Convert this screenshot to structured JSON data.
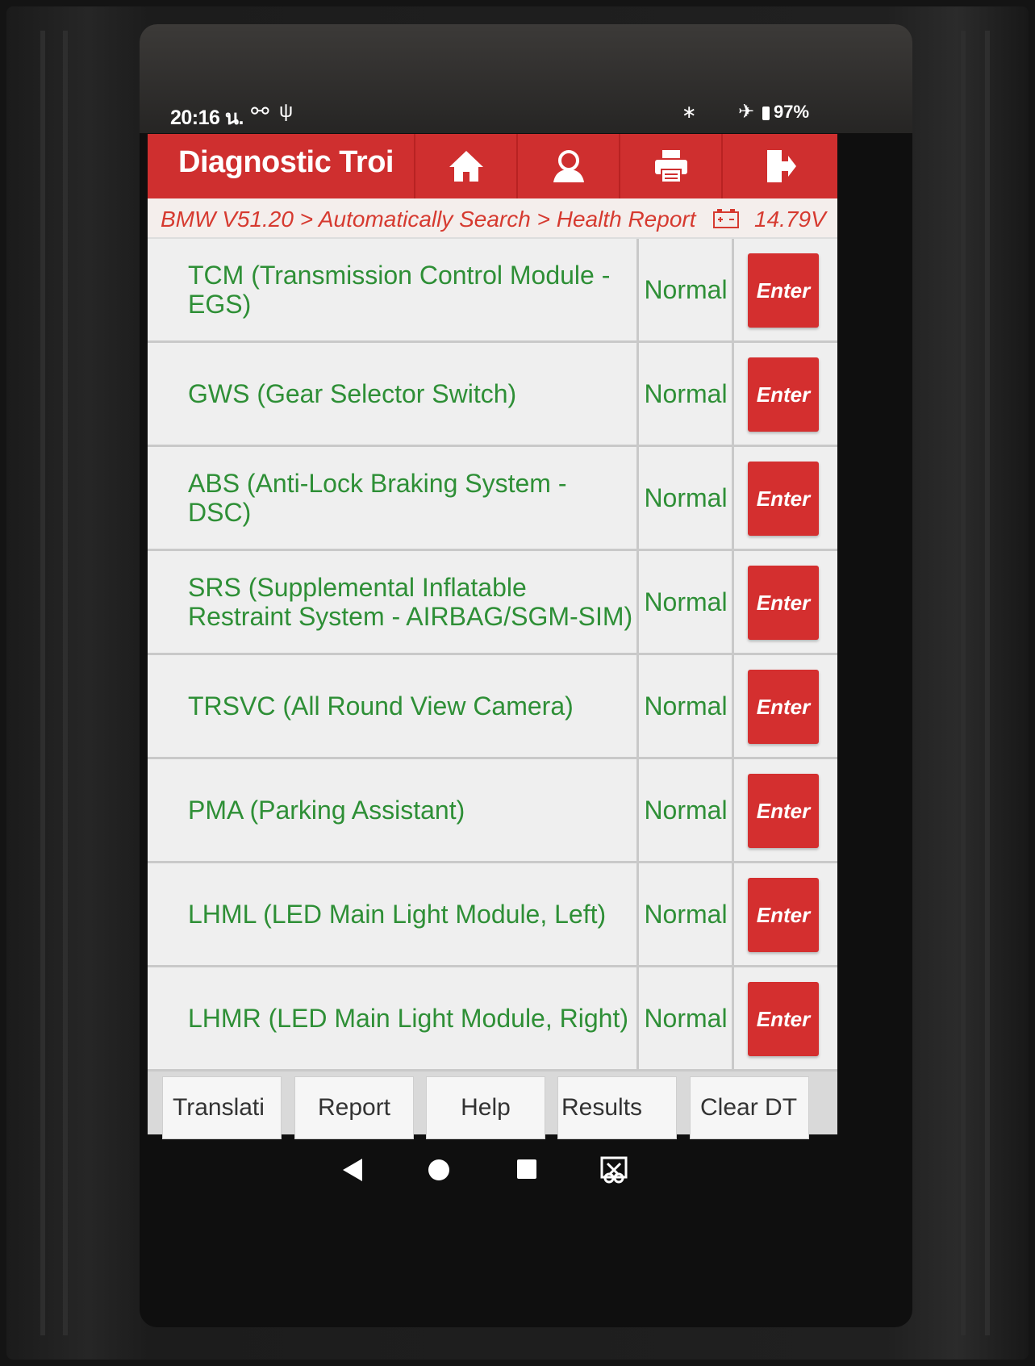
{
  "status_bar": {
    "time": "20:16 น.",
    "battery": "97%"
  },
  "header": {
    "title": "Diagnostic Troi",
    "icons": [
      "home-icon",
      "user-icon",
      "print-icon",
      "exit-icon"
    ]
  },
  "breadcrumb": {
    "path": "BMW V51.20 > Automatically Search > Health Report",
    "voltage": "14.79V"
  },
  "modules": [
    {
      "name": "TCM (Transmission Control Module - EGS)",
      "status": "Normal",
      "action": "Enter"
    },
    {
      "name": "GWS (Gear Selector Switch)",
      "status": "Normal",
      "action": "Enter"
    },
    {
      "name": "ABS (Anti-Lock Braking System - DSC)",
      "status": "Normal",
      "action": "Enter"
    },
    {
      "name": "SRS (Supplemental Inflatable Restraint System - AIRBAG/SGM-SIM)",
      "status": "Normal",
      "action": "Enter"
    },
    {
      "name": "TRSVC (All Round View Camera)",
      "status": "Normal",
      "action": "Enter"
    },
    {
      "name": "PMA (Parking Assistant)",
      "status": "Normal",
      "action": "Enter"
    },
    {
      "name": "LHML (LED Main Light Module, Left)",
      "status": "Normal",
      "action": "Enter"
    },
    {
      "name": "LHMR (LED Main Light Module, Right)",
      "status": "Normal",
      "action": "Enter"
    }
  ],
  "bottom_buttons": [
    "Translati",
    "Report",
    "Help",
    "Results",
    "Clear DT"
  ],
  "colors": {
    "header_red": "#cf2f2f",
    "module_green": "#2e8f36",
    "enter_red": "#d42f2f"
  }
}
